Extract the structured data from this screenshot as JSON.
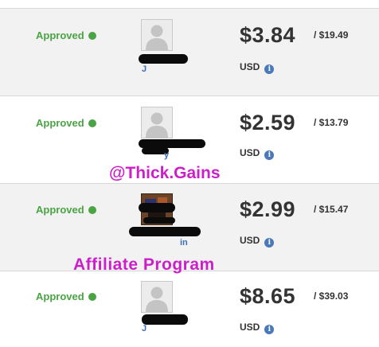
{
  "rows": [
    {
      "status": "Approved",
      "user_initial": "J",
      "amount": "$3.84",
      "total": "/ $19.49",
      "currency": "USD"
    },
    {
      "status": "Approved",
      "user_initial": "y",
      "amount": "$2.59",
      "total": "/ $13.79",
      "currency": "USD"
    },
    {
      "status": "Approved",
      "user_initial": "in",
      "amount": "$2.99",
      "total": "/ $15.47",
      "currency": "USD"
    },
    {
      "status": "Approved",
      "user_initial": "J",
      "amount": "$8.65",
      "total": "/ $39.03",
      "currency": "USD"
    }
  ],
  "overlay": {
    "handle": "@Thick.Gains",
    "caption": "Affiliate Program"
  },
  "colors": {
    "status_green": "#4aa443",
    "link_blue": "#3b6fb5",
    "overlay_magenta": "#cc1fc9"
  },
  "icons": {
    "status": "status-dot-icon",
    "info": "info-icon",
    "avatar": "default-avatar-icon"
  }
}
